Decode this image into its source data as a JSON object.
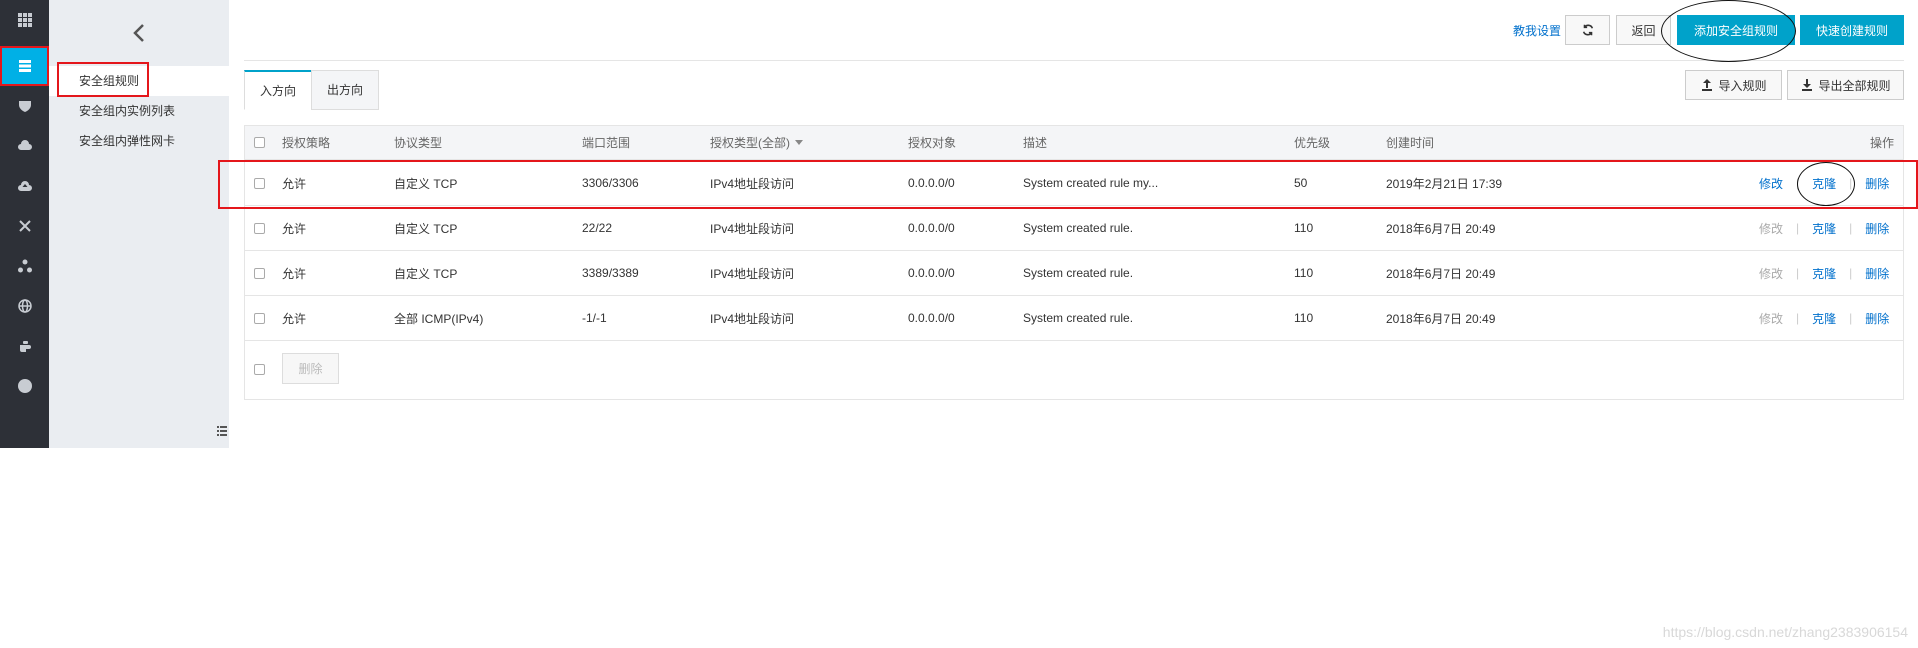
{
  "rail": {
    "items": [
      {
        "icon": "grid-icon"
      },
      {
        "icon": "server-icon",
        "active": true
      },
      {
        "icon": "shield-icon"
      },
      {
        "icon": "cloud-icon"
      },
      {
        "icon": "cloud-upload-icon"
      },
      {
        "icon": "network-icon"
      },
      {
        "icon": "cluster-icon"
      },
      {
        "icon": "globe-icon"
      },
      {
        "icon": "hand-icon"
      },
      {
        "icon": "circle-icon"
      }
    ]
  },
  "subnav": {
    "items": [
      {
        "label": "安全组规则",
        "active": true
      },
      {
        "label": "安全组内实例列表"
      },
      {
        "label": "安全组内弹性网卡"
      }
    ]
  },
  "header": {
    "help_link": "教我设置",
    "back_label": "返回",
    "add_rule_label": "添加安全组规则",
    "quick_create_label": "快速创建规则"
  },
  "tabs": [
    {
      "label": "入方向",
      "active": true
    },
    {
      "label": "出方向"
    }
  ],
  "actions": {
    "import_label": "导入规则",
    "export_label": "导出全部规则"
  },
  "table": {
    "columns": [
      "授权策略",
      "协议类型",
      "端口范围",
      "授权类型(全部)",
      "授权对象",
      "描述",
      "优先级",
      "创建时间",
      "操作"
    ],
    "rows": [
      {
        "policy": "允许",
        "protocol": "自定义 TCP",
        "port": "3306/3306",
        "auth_type": "IPv4地址段访问",
        "target": "0.0.0.0/0",
        "desc": "System created rule my...",
        "priority": "50",
        "created": "2019年2月21日 17:39",
        "edit": "修改",
        "clone": "克隆",
        "delete": "删除",
        "edit_enabled": true
      },
      {
        "policy": "允许",
        "protocol": "自定义 TCP",
        "port": "22/22",
        "auth_type": "IPv4地址段访问",
        "target": "0.0.0.0/0",
        "desc": "System created rule.",
        "priority": "110",
        "created": "2018年6月7日 20:49",
        "edit": "修改",
        "clone": "克隆",
        "delete": "删除",
        "edit_enabled": false
      },
      {
        "policy": "允许",
        "protocol": "自定义 TCP",
        "port": "3389/3389",
        "auth_type": "IPv4地址段访问",
        "target": "0.0.0.0/0",
        "desc": "System created rule.",
        "priority": "110",
        "created": "2018年6月7日 20:49",
        "edit": "修改",
        "clone": "克隆",
        "delete": "删除",
        "edit_enabled": false
      },
      {
        "policy": "允许",
        "protocol": "全部 ICMP(IPv4)",
        "port": "-1/-1",
        "auth_type": "IPv4地址段访问",
        "target": "0.0.0.0/0",
        "desc": "System created rule.",
        "priority": "110",
        "created": "2018年6月7日 20:49",
        "edit": "修改",
        "clone": "克隆",
        "delete": "删除",
        "edit_enabled": false
      }
    ],
    "bulk_delete_label": "删除"
  },
  "watermark": "https://blog.csdn.net/zhang2383906154",
  "colors": {
    "primary": "#00a2ca",
    "rail_active": "#00b0e6",
    "link": "#0070cc",
    "annotation": "#e4161b"
  }
}
